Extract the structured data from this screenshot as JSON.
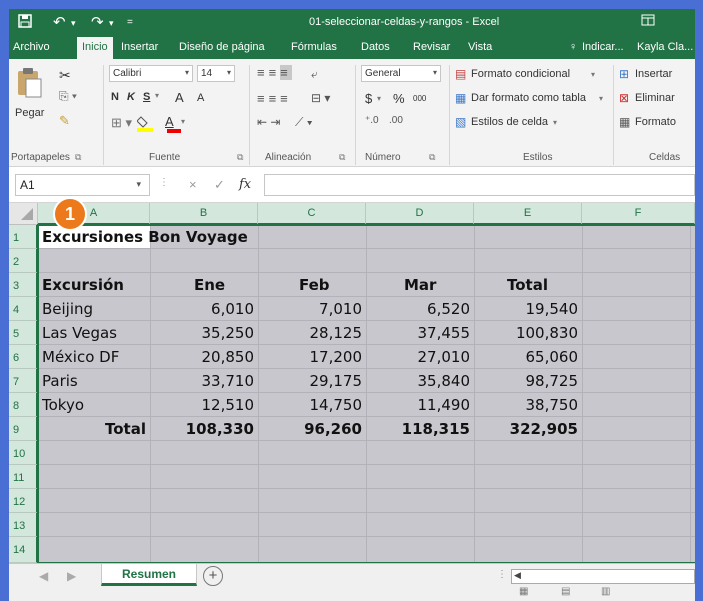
{
  "window": {
    "title": "01-seleccionar-celdas-y-rangos - Excel",
    "icons": [
      "save-icon",
      "undo-icon",
      "redo-icon",
      "customize-icon",
      "ribbon-display-icon"
    ]
  },
  "tabs": [
    {
      "label": "Archivo"
    },
    {
      "label": "Inicio"
    },
    {
      "label": "Insertar"
    },
    {
      "label": "Diseño de página"
    },
    {
      "label": "Fórmulas"
    },
    {
      "label": "Datos"
    },
    {
      "label": "Revisar"
    },
    {
      "label": "Vista"
    }
  ],
  "tell_me": "Indicar...",
  "user": "Kayla Cla...",
  "ribbon": {
    "clipboard": {
      "paste": "Pegar",
      "label": "Portapapeles"
    },
    "font": {
      "name": "Calibri",
      "size": "14",
      "bold": "N",
      "italic": "K",
      "underline": "S",
      "grow": "A",
      "shrink": "A",
      "color_letter": "A",
      "label": "Fuente"
    },
    "alignment": {
      "label": "Alineación"
    },
    "number": {
      "format": "General",
      "currency": "$",
      "percent": "%",
      "thousands": "000",
      "label": "Número"
    },
    "styles": {
      "conditional": "Formato condicional",
      "table": "Dar formato como tabla",
      "cell_styles": "Estilos de celda",
      "label": "Estilos"
    },
    "cells": {
      "insert": "Insertar",
      "delete": "Eliminar",
      "format": "Formato",
      "label": "Celdas"
    }
  },
  "formula_bar": {
    "name_box": "A1",
    "cancel": "×",
    "enter": "✓",
    "fx": "fx",
    "value": ""
  },
  "columns": [
    "A",
    "B",
    "C",
    "D",
    "E",
    "F"
  ],
  "rows": [
    "1",
    "2",
    "3",
    "4",
    "5",
    "6",
    "7",
    "8",
    "9",
    "10",
    "11",
    "12",
    "13",
    "14"
  ],
  "sheet": {
    "title": "Excursiones Bon Voyage",
    "headers": [
      "Excursión",
      "Ene",
      "Feb",
      "Mar",
      "Total"
    ],
    "data": [
      [
        "Beijing",
        "6,010",
        "7,010",
        "6,520",
        "19,540"
      ],
      [
        "Las Vegas",
        "35,250",
        "28,125",
        "37,455",
        "100,830"
      ],
      [
        "México DF",
        "20,850",
        "17,200",
        "27,010",
        "65,060"
      ],
      [
        "Paris",
        "33,710",
        "29,175",
        "35,840",
        "98,725"
      ],
      [
        "Tokyo",
        "12,510",
        "14,750",
        "11,490",
        "38,750"
      ]
    ],
    "totals": [
      "Total",
      "108,330",
      "96,260",
      "118,315",
      "322,905"
    ]
  },
  "callout": "1",
  "sheet_tabs": [
    {
      "label": "Resumen"
    }
  ],
  "colors": {
    "excel_green": "#217346",
    "selection": "#c7c7cd",
    "header_selected": "#d3e7dc",
    "callout": "#ec7a1c",
    "background": "#4a6fd4"
  }
}
